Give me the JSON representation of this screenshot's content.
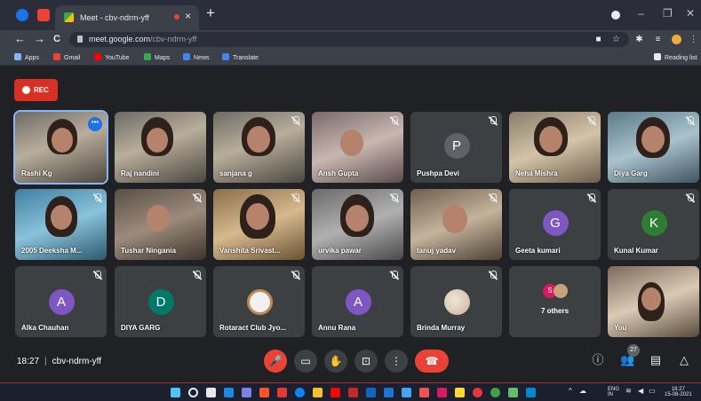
{
  "browser": {
    "tab_title": "Meet - cbv-ndrm-yff",
    "tab_close": "×",
    "new_tab": "+",
    "url_host": "meet.google.com",
    "url_path": "/cbv-ndrm-yff",
    "nav": {
      "back": "←",
      "forward": "→",
      "reload": "C"
    },
    "window": {
      "minimize": "–",
      "restore": "❐",
      "close": "✕"
    }
  },
  "bookmarks": {
    "items": [
      "Apps",
      "Gmail",
      "YouTube",
      "Maps",
      "News",
      "Translate"
    ],
    "reading_list": "Reading list"
  },
  "meet": {
    "rec_label": "REC",
    "tiles": [
      {
        "name": "Rashi Kg",
        "type": "video",
        "muted": false,
        "active": true
      },
      {
        "name": "Raj nandini",
        "type": "video",
        "muted": false
      },
      {
        "name": "sanjana g",
        "type": "video",
        "muted": true
      },
      {
        "name": "Ansh Gupta",
        "type": "video",
        "muted": true
      },
      {
        "name": "Pushpa Devi",
        "type": "avatar",
        "letter": "P",
        "color": "#5f6368",
        "muted": true
      },
      {
        "name": "Neha Mishra",
        "type": "video",
        "muted": true
      },
      {
        "name": "Diya Garg",
        "type": "video",
        "muted": true
      },
      {
        "name": "2005 Deeksha M...",
        "type": "video",
        "muted": true
      },
      {
        "name": "Tushar Ninganiа",
        "type": "video",
        "muted": true
      },
      {
        "name": "Vanshita Srivast...",
        "type": "video",
        "muted": true
      },
      {
        "name": "urvika pawar",
        "type": "video",
        "muted": true
      },
      {
        "name": "tanuj yadav",
        "type": "video",
        "muted": true
      },
      {
        "name": "Geeta kumari",
        "type": "avatar",
        "letter": "G",
        "color": "#7e57c2",
        "muted": true
      },
      {
        "name": "Kunal Kumar",
        "type": "avatar",
        "letter": "K",
        "color": "#2e7d32",
        "muted": true
      },
      {
        "name": "Alka Chauhan",
        "type": "avatar",
        "letter": "A",
        "color": "#7e57c2",
        "muted": true
      },
      {
        "name": "DIYA GARG",
        "type": "avatar",
        "letter": "D",
        "color": "#00796b",
        "muted": true
      },
      {
        "name": "Rotaract Club Jyo...",
        "type": "logo",
        "muted": true
      },
      {
        "name": "Annu Rana",
        "type": "avatar",
        "letter": "A",
        "color": "#7e57c2",
        "muted": true
      },
      {
        "name": "Brinda Murray",
        "type": "photo",
        "muted": true
      },
      {
        "name": "7 others",
        "type": "others"
      },
      {
        "name": "You",
        "type": "video"
      }
    ],
    "more_dots": "•••",
    "time": "18:27",
    "meeting_code": "cbv-ndrm-yff",
    "participants_count": "27",
    "colors": {
      "accent": "#1a73e8",
      "hangup": "#ea4335",
      "bg": "#202124",
      "tile": "#3c4043"
    }
  },
  "controls": {
    "mic": "mic-off-icon",
    "camera": "camera-icon",
    "hand": "raise-hand-icon",
    "present": "present-icon",
    "more": "more-icon",
    "hangup": "hangup-icon"
  },
  "taskbar": {
    "lang_top": "ENG",
    "lang_bottom": "IN",
    "clock_time": "18:27",
    "clock_date": "15-08-2021"
  }
}
